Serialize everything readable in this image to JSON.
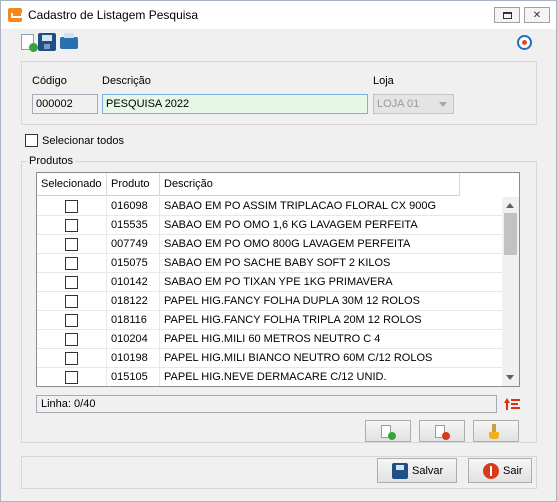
{
  "window": {
    "title": "Cadastro de Listagem Pesquisa",
    "restore_icon": "restore-icon",
    "close_glyph": "✕"
  },
  "toolbar": {
    "icons": [
      "new-document-icon",
      "save-icon",
      "print-icon",
      "help-icon"
    ]
  },
  "form": {
    "code_label": "Código",
    "code_value": "000002",
    "description_label": "Descrição",
    "description_value": "PESQUISA 2022",
    "store_label": "Loja",
    "store_value": "LOJA 01"
  },
  "select_all": {
    "label": "Selecionar todos",
    "checked": false
  },
  "products": {
    "group_title": "Produtos",
    "columns": [
      "Selecionado",
      "Produto",
      "Descrição"
    ],
    "rows": [
      {
        "selected": false,
        "code": "016098",
        "description": "SABAO EM PO ASSIM TRIPLACAO FLORAL CX 900G"
      },
      {
        "selected": false,
        "code": "015535",
        "description": "SABAO EM PO OMO 1,6 KG  LAVAGEM PERFEITA"
      },
      {
        "selected": false,
        "code": "007749",
        "description": "SABAO EM PO OMO 800G LAVAGEM PERFEITA"
      },
      {
        "selected": false,
        "code": "015075",
        "description": "SABAO EM PO SACHE BABY SOFT 2 KILOS"
      },
      {
        "selected": false,
        "code": "010142",
        "description": "SABAO EM PO TIXAN YPE 1KG PRIMAVERA"
      },
      {
        "selected": false,
        "code": "018122",
        "description": "PAPEL HIG.FANCY FOLHA DUPLA 30M 12 ROLOS"
      },
      {
        "selected": false,
        "code": "018116",
        "description": "PAPEL HIG.FANCY FOLHA TRIPLA 20M 12 ROLOS"
      },
      {
        "selected": false,
        "code": "010204",
        "description": "PAPEL HIG.MILI 60 METROS NEUTRO C 4"
      },
      {
        "selected": false,
        "code": "010198",
        "description": "PAPEL HIG.MILI BIANCO NEUTRO 60M C/12 ROLOS"
      },
      {
        "selected": false,
        "code": "015105",
        "description": "PAPEL HIG.NEVE DERMACARE C/12 UNID."
      }
    ],
    "status_text": "Linha: 0/40"
  },
  "buttons": {
    "save_label": "Salvar",
    "exit_label": "Sair"
  },
  "colors": {
    "accent_green": "#35a53a",
    "accent_red": "#d83a1a",
    "brand_orange": "#f08a1e",
    "field_highlight": "#e6f6e7"
  }
}
